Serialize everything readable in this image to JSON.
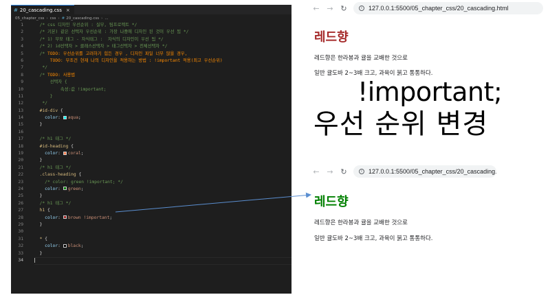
{
  "editor": {
    "tab": {
      "label": "20_cascading.css",
      "close_glyph": "×"
    },
    "breadcrumb": [
      "05_chapter_css",
      "css",
      "20_cascading.css",
      "..."
    ],
    "lines": [
      {
        "n": "1",
        "segs": [
          {
            "c": "comment",
            "t": "  /* css 디자인 우선순위 : 실무, 팀프로젝트 */"
          }
        ]
      },
      {
        "n": "2",
        "segs": [
          {
            "c": "comment",
            "t": "  /* 기본) 같은 선택자 우선순위 : 가장 나중에 디자인 된 것이 우선 됨 */"
          }
        ]
      },
      {
        "n": "3",
        "segs": [
          {
            "c": "comment",
            "t": "  /* 1) 부모 태그 - 자식태그 :  자식의 디자인이 우선 됨 */"
          }
        ]
      },
      {
        "n": "4",
        "segs": [
          {
            "c": "comment",
            "t": "  /* 2) id선택자 > 클래스선택자 > 태그선택자 > 전체선택자 */"
          }
        ]
      },
      {
        "n": "5",
        "segs": [
          {
            "c": "comment",
            "t": "  /* "
          },
          {
            "c": "todo",
            "t": "TODO: 우선순위를 고려하기 힘든 경우 , 디자인 파일 너무 많을 경우,"
          }
        ]
      },
      {
        "n": "6",
        "segs": [
          {
            "c": "todo",
            "t": "      TODO: 무조건 현재 나의 디자인을 적용하는 방법 : !important 적용(최고 우선순위)"
          }
        ]
      },
      {
        "n": "7",
        "segs": [
          {
            "c": "comment",
            "t": "   */"
          }
        ]
      },
      {
        "n": "8",
        "segs": [
          {
            "c": "comment",
            "t": "  /* "
          },
          {
            "c": "todo",
            "t": "TODO: 사용법"
          }
        ]
      },
      {
        "n": "9",
        "segs": [
          {
            "c": "comment",
            "t": "      선택자 {"
          }
        ]
      },
      {
        "n": "10",
        "segs": [
          {
            "c": "comment",
            "t": "          속성:값 !important;"
          }
        ]
      },
      {
        "n": "11",
        "segs": [
          {
            "c": "comment",
            "t": "      }"
          }
        ]
      },
      {
        "n": "12",
        "segs": [
          {
            "c": "comment",
            "t": "   */"
          }
        ]
      },
      {
        "n": "13",
        "segs": [
          {
            "c": "selector",
            "t": "  #id-div"
          },
          {
            "c": "punct",
            "t": " {"
          }
        ]
      },
      {
        "n": "14",
        "segs": [
          {
            "c": "prop",
            "t": "    color"
          },
          {
            "c": "punct",
            "t": ": "
          },
          {
            "c": "swatch",
            "color": "#00ffff"
          },
          {
            "c": "val",
            "t": "aqua"
          },
          {
            "c": "punct",
            "t": ";"
          }
        ]
      },
      {
        "n": "15",
        "segs": [
          {
            "c": "punct",
            "t": "  }"
          }
        ]
      },
      {
        "n": "16",
        "segs": []
      },
      {
        "n": "17",
        "segs": [
          {
            "c": "comment",
            "t": "  /* h1 태그 */"
          }
        ]
      },
      {
        "n": "18",
        "segs": [
          {
            "c": "selector",
            "t": "  #id-heading"
          },
          {
            "c": "punct",
            "t": " {"
          }
        ]
      },
      {
        "n": "19",
        "segs": [
          {
            "c": "prop",
            "t": "    color"
          },
          {
            "c": "punct",
            "t": ": "
          },
          {
            "c": "swatch",
            "color": "#ff7f50"
          },
          {
            "c": "val",
            "t": "coral"
          },
          {
            "c": "punct",
            "t": ";"
          }
        ]
      },
      {
        "n": "20",
        "segs": [
          {
            "c": "punct",
            "t": "  }"
          }
        ]
      },
      {
        "n": "21",
        "segs": [
          {
            "c": "comment",
            "t": "  /* h1 태그 */"
          }
        ]
      },
      {
        "n": "22",
        "segs": [
          {
            "c": "selector",
            "t": "  .class-heading"
          },
          {
            "c": "punct",
            "t": " {"
          }
        ]
      },
      {
        "n": "23",
        "segs": [
          {
            "c": "comment",
            "t": "    /* color: green !important; */"
          }
        ]
      },
      {
        "n": "24",
        "segs": [
          {
            "c": "prop",
            "t": "    color"
          },
          {
            "c": "punct",
            "t": ": "
          },
          {
            "c": "swatch",
            "color": "#008000"
          },
          {
            "c": "val",
            "t": "green"
          },
          {
            "c": "punct",
            "t": ";"
          }
        ]
      },
      {
        "n": "25",
        "segs": [
          {
            "c": "punct",
            "t": "  }"
          }
        ]
      },
      {
        "n": "26",
        "segs": [
          {
            "c": "comment",
            "t": "  /* h1 태그 */"
          }
        ]
      },
      {
        "n": "27",
        "segs": [
          {
            "c": "selector",
            "t": "  h1"
          },
          {
            "c": "punct",
            "t": " {"
          }
        ]
      },
      {
        "n": "28",
        "segs": [
          {
            "c": "prop",
            "t": "    color"
          },
          {
            "c": "punct",
            "t": ": "
          },
          {
            "c": "swatch",
            "color": "#a52a2a"
          },
          {
            "c": "val",
            "t": "brown !important"
          },
          {
            "c": "punct",
            "t": ";"
          }
        ]
      },
      {
        "n": "29",
        "segs": [
          {
            "c": "punct",
            "t": "  }"
          }
        ]
      },
      {
        "n": "30",
        "segs": []
      },
      {
        "n": "31",
        "segs": [
          {
            "c": "selector",
            "t": "  *"
          },
          {
            "c": "punct",
            "t": " {"
          }
        ]
      },
      {
        "n": "32",
        "segs": [
          {
            "c": "prop",
            "t": "    color"
          },
          {
            "c": "punct",
            "t": ": "
          },
          {
            "c": "swatch",
            "color": "#000000"
          },
          {
            "c": "val",
            "t": "black"
          },
          {
            "c": "punct",
            "t": ";"
          }
        ]
      },
      {
        "n": "33",
        "segs": [
          {
            "c": "punct",
            "t": "  }"
          }
        ]
      },
      {
        "n": "34",
        "segs": [
          {
            "c": "caret"
          }
        ],
        "active": true
      }
    ]
  },
  "browser_top": {
    "url": "127.0.0.1:5500/05_chapter_css/20_cascading.html",
    "back_glyph": "←",
    "forward_glyph": "→",
    "reload_glyph": "↻",
    "heading": "레드향",
    "heading_color": "#a52a2a",
    "para1": "레드향은 한라봉과 귤을 교배한 것으로",
    "para2": "일반 귤도바 2~3배 크고, 과육이 붉고 통통하다."
  },
  "annotation": {
    "line1": "!important;",
    "line2": "우선 순위 변경"
  },
  "browser_bottom": {
    "url": "127.0.0.1:5500/05_chapter_css/20_cascading.l",
    "back_glyph": "←",
    "forward_glyph": "→",
    "reload_glyph": "↻",
    "heading": "레드향",
    "heading_color": "#008000",
    "para1": "레드향은 한라봉과 귤을 교배한 것으로",
    "para2": "일반 귤도바 2~3배 크고, 과육이 붉고 통통하다."
  }
}
